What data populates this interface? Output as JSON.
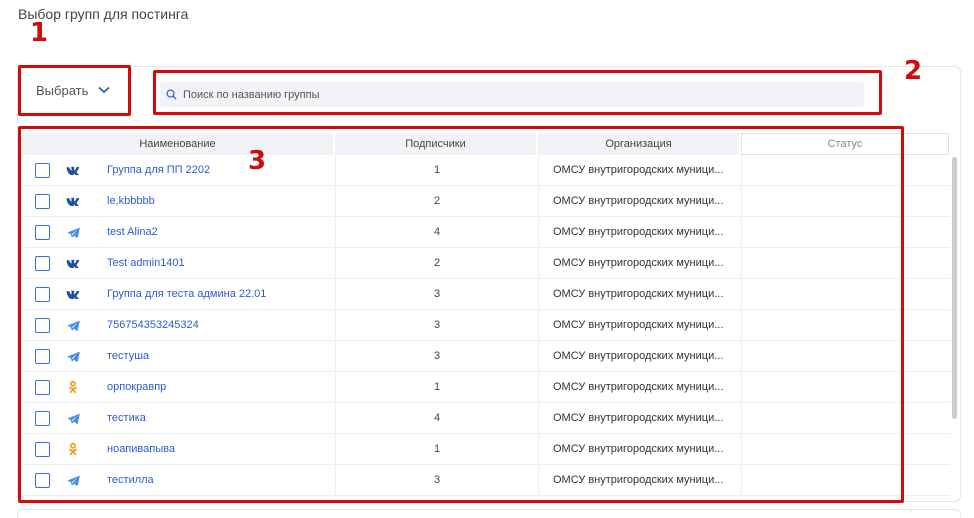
{
  "page": {
    "title": "Выбор групп для постинга"
  },
  "toolbar": {
    "select_label": "Выбрать"
  },
  "search": {
    "placeholder": "Поиск по названию группы"
  },
  "table": {
    "headers": {
      "name": "Наименование",
      "subscribers": "Подписчики",
      "organization": "Организация",
      "status": "Статус"
    },
    "rows": [
      {
        "network": "vk",
        "name": "Группа для ПП 2202",
        "subscribers": "1",
        "organization": "ОМСУ внутригородских муници..."
      },
      {
        "network": "vk",
        "name": "le,kbbbbb",
        "subscribers": "2",
        "organization": "ОМСУ внутригородских муници..."
      },
      {
        "network": "telegram",
        "name": "test Alina2",
        "subscribers": "4",
        "organization": "ОМСУ внутригородских муници..."
      },
      {
        "network": "vk",
        "name": "Test admin1401",
        "subscribers": "2",
        "organization": "ОМСУ внутригородских муници..."
      },
      {
        "network": "vk",
        "name": "Группа для теста админа 22.01",
        "subscribers": "3",
        "organization": "ОМСУ внутригородских муници..."
      },
      {
        "network": "telegram",
        "name": "756754353245324",
        "subscribers": "3",
        "organization": "ОМСУ внутригородских муници..."
      },
      {
        "network": "telegram",
        "name": "тестуша",
        "subscribers": "3",
        "organization": "ОМСУ внутригородских муници..."
      },
      {
        "network": "ok",
        "name": "орпокравпр",
        "subscribers": "1",
        "organization": "ОМСУ внутригородских муници..."
      },
      {
        "network": "telegram",
        "name": "тестика",
        "subscribers": "4",
        "organization": "ОМСУ внутригородских муници..."
      },
      {
        "network": "ok",
        "name": "ноапивапыва",
        "subscribers": "1",
        "organization": "ОМСУ внутригородских муници..."
      },
      {
        "network": "telegram",
        "name": "тестилла",
        "subscribers": "3",
        "organization": "ОМСУ внутригородских муници..."
      }
    ]
  },
  "annotations": [
    "1",
    "2",
    "3"
  ],
  "colors": {
    "accent": "#2d5bd0",
    "annotation": "#d10b0b",
    "ok": "#f0960f",
    "telegram": "#4a90e2",
    "vk": "#1f4fa3"
  }
}
